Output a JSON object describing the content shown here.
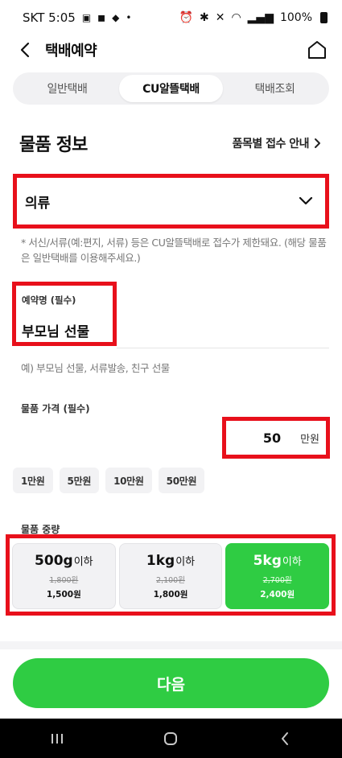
{
  "status_bar": {
    "carrier_time": "SKT 5:05",
    "battery": "100%"
  },
  "header": {
    "title": "택배예약"
  },
  "tabs": [
    {
      "label": "일반택배",
      "active": false
    },
    {
      "label": "CU알뜰택배",
      "active": true
    },
    {
      "label": "택배조회",
      "active": false
    }
  ],
  "section": {
    "title": "물품 정보",
    "guide_link": "품목별 접수 안내"
  },
  "category": {
    "selected": "의류"
  },
  "notice": "* 서신/서류(예:편지, 서류) 등은 CU알뜰택배로 접수가 제한돼요. (해당 물품은 일반택배를 이용해주세요.)",
  "reservation_name": {
    "label": "예약명 (필수)",
    "value": "부모님 선물",
    "example": "예) 부모님 선물, 서류발송, 친구 선물"
  },
  "price": {
    "label": "물품 가격 (필수)",
    "value": "50",
    "unit": "만원",
    "chips": [
      "1만원",
      "5만원",
      "10만원",
      "50만원"
    ]
  },
  "weight": {
    "label": "물품 중량",
    "options": [
      {
        "size": "500g",
        "suffix": "이하",
        "original": "1,800원",
        "price": "1,500원",
        "selected": false
      },
      {
        "size": "1kg",
        "suffix": "이하",
        "original": "2,100원",
        "price": "1,800원",
        "selected": false
      },
      {
        "size": "5kg",
        "suffix": "이하",
        "original": "2,700원",
        "price": "2,400원",
        "selected": true
      }
    ]
  },
  "next_button": "다음",
  "colors": {
    "accent": "#2fcc43",
    "highlight": "#e8101b"
  }
}
